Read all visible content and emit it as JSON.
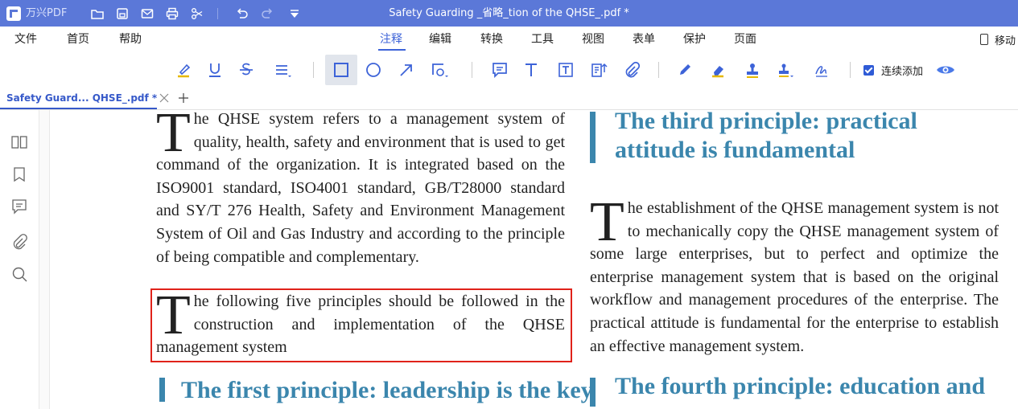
{
  "titlebar": {
    "app_name": "万兴PDF",
    "document_title": "Safety Guarding _省略_tion of the QHSE_.pdf *",
    "icons": [
      "folder-icon",
      "save-icon",
      "mail-icon",
      "print-icon",
      "scissors-icon",
      "undo-icon",
      "redo-icon",
      "dropdown-icon"
    ]
  },
  "menu": {
    "items": [
      "文件",
      "首页",
      "帮助",
      "注释",
      "编辑",
      "转换",
      "工具",
      "视图",
      "表单",
      "保护",
      "页面"
    ],
    "active": "注释",
    "mobile_label": "移动"
  },
  "toolbar": {
    "continuous_add_label": "连续添加",
    "continuous_add_checked": true,
    "accent_color": "#2f5bd6"
  },
  "tab": {
    "label": "Safety Guard... QHSE_.pdf *"
  },
  "document": {
    "left_para1_dropcap": "T",
    "left_para1": "he QHSE system refers to a management system of quality, health, safety and environment that is used to get command of the organization. It is integrated based on the ISO9001 standard, ISO4001 standard, GB/T28000 standard and SY/T 276 Health, Safety and Environment Management System of Oil and Gas Industry and according to the principle of being compatible and complementary.",
    "left_para2_dropcap": "T",
    "left_para2": "he following five principles should be followed in the construction and implementation of the QHSE management system",
    "left_heading": "The first principle: leadership is the key",
    "right_heading1": "The third principle: practical attitude is fundamental",
    "right_para_dropcap": "T",
    "right_para": "he establishment of the QHSE management system is not to mechanically copy the QHSE management system of some large enterprises, but to perfect and optimize the enterprise management system that is based on the original workflow and management procedures of the enterprise. The practical attitude is fundamental for the enterprise to establish an effective management system.",
    "right_heading2": "The fourth principle: education and",
    "heading_color": "#3b86ad",
    "selection_color": "#e0221a"
  }
}
